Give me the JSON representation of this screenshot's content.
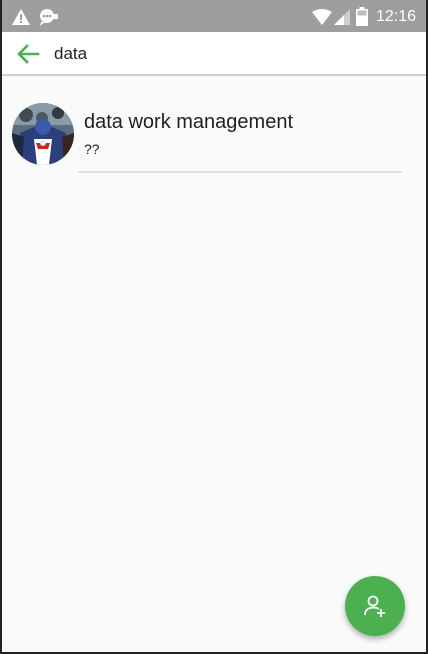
{
  "status_bar": {
    "time": "12:16",
    "icons": [
      "warning-icon",
      "notification-bubble-icon",
      "wifi-icon",
      "signal-icon",
      "battery-icon"
    ]
  },
  "search": {
    "query": "data",
    "back_icon": "arrow-left-icon"
  },
  "results": [
    {
      "title": "data work management",
      "subtitle": "??",
      "avatar": "group-avatar"
    }
  ],
  "fab": {
    "icon": "add-person-icon",
    "color": "#4caf50"
  },
  "colors": {
    "accent": "#4caf50",
    "status_bar": "#9e9e9e",
    "background": "#fafafa"
  }
}
